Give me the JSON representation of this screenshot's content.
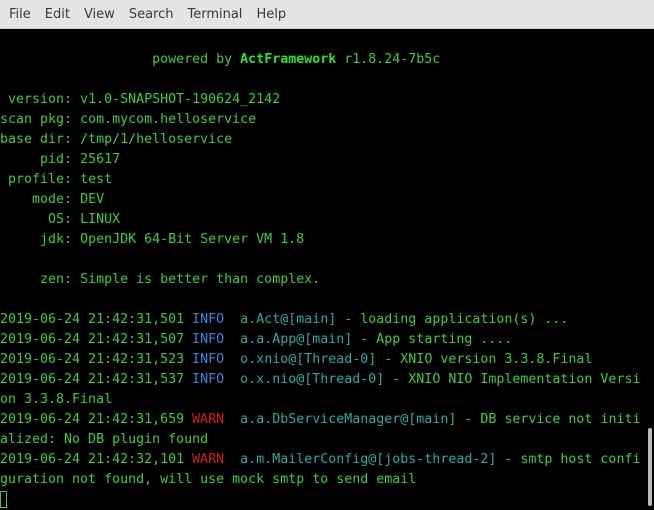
{
  "menu": [
    "File",
    "Edit",
    "View",
    "Search",
    "Terminal",
    "Help"
  ],
  "banner": {
    "prefix": "powered by ",
    "brand": "ActFramework",
    "suffix": " r1.8.24-7b5c"
  },
  "info": [
    {
      "key": " version: ",
      "value": "v1.0-SNAPSHOT-190624_2142"
    },
    {
      "key": "scan pkg: ",
      "value": "com.mycom.helloservice"
    },
    {
      "key": "base dir: ",
      "value": "/tmp/1/helloservice"
    },
    {
      "key": "     pid: ",
      "value": "25617"
    },
    {
      "key": " profile: ",
      "value": "test"
    },
    {
      "key": "    mode: ",
      "value": "DEV"
    },
    {
      "key": "      OS: ",
      "value": "LINUX"
    },
    {
      "key": "     jdk: ",
      "value": "OpenJDK 64-Bit Server VM 1.8"
    }
  ],
  "zen": {
    "key": "     zen: ",
    "value": "Simple is better than complex."
  },
  "logs": [
    {
      "ts": "2019-06-24 21:42:31,501 ",
      "level": "INFO",
      "logger": "  a.Act@[main]",
      "msg": " - loading application(s) ...",
      "cont": ""
    },
    {
      "ts": "2019-06-24 21:42:31,507 ",
      "level": "INFO",
      "logger": "  a.a.App@[main]",
      "msg": " - App starting ....",
      "cont": ""
    },
    {
      "ts": "2019-06-24 21:42:31,523 ",
      "level": "INFO",
      "logger": "  o.xnio@[Thread-0]",
      "msg": " - XNIO version 3.3.8.Final",
      "cont": ""
    },
    {
      "ts": "2019-06-24 21:42:31,537 ",
      "level": "INFO",
      "logger": "  o.x.nio@[Thread-0]",
      "msg": " - XNIO NIO Implementation Versi",
      "cont": "on 3.3.8.Final"
    },
    {
      "ts": "2019-06-24 21:42:31,659 ",
      "level": "WARN",
      "logger": "  a.a.DbServiceManager@[main]",
      "msg": " - DB service not initi",
      "cont": "alized: No DB plugin found"
    },
    {
      "ts": "2019-06-24 21:42:32,101 ",
      "level": "WARN",
      "logger": "  a.m.MailerConfig@[jobs-thread-2]",
      "msg": " - smtp host confi",
      "cont": "guration not found, will use mock smtp to send email"
    }
  ]
}
